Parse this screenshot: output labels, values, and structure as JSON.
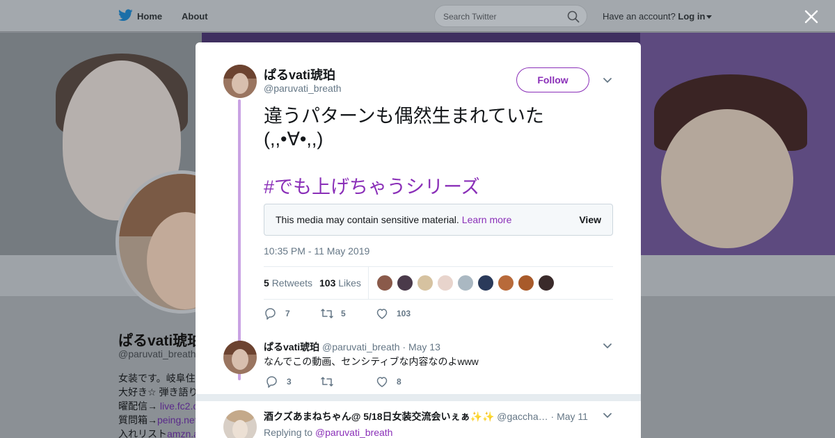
{
  "nav": {
    "home": "Home",
    "about": "About",
    "search_placeholder": "Search Twitter",
    "have_account": "Have an account?",
    "login": "Log in"
  },
  "background_profile": {
    "name": "ぱるvati琥珀",
    "handle": "@paruvati_breath",
    "bio_lines": [
      {
        "text": "女装です。岐阜住",
        "link": ""
      },
      {
        "text": "大好き☆ 弾き語り",
        "link": ""
      },
      {
        "text": "曜配信→ ",
        "link": "live.fc2.c"
      },
      {
        "text": "質問箱→",
        "link": "peing.net"
      },
      {
        "text": "入れリスト",
        "link": "amzn.a"
      }
    ]
  },
  "tweet": {
    "author_name": "ぱるvati琥珀",
    "author_handle": "@paruvati_breath",
    "follow_label": "Follow",
    "text_line1": "違うパターンも偶然生まれていた",
    "text_line2": "(,,•∀•,,)",
    "hashtag": "#でも上げちゃうシリーズ",
    "sensitive_message": "This media may contain sensitive material.",
    "learn_more": "Learn more",
    "view_label": "View",
    "timestamp": "10:35 PM - 11 May 2019",
    "retweets_count": "5",
    "retweets_label": "Retweets",
    "likes_count": "103",
    "likes_label": "Likes",
    "actions": {
      "reply": "7",
      "retweet": "5",
      "like": "103"
    },
    "liker_avatar_colors": [
      "#8a5a4a",
      "#4a3a4a",
      "#d6c2a0",
      "#e8d4cc",
      "#aab8c2",
      "#2a3a5a",
      "#b86a3a",
      "#a85a2a",
      "#3a2a2a"
    ]
  },
  "replies": [
    {
      "name": "ぱるvati琥珀",
      "handle": "@paruvati_breath",
      "date": "· May 13",
      "text": "なんでこの動画、センシティブな内容なのよwww",
      "reply_count": "3",
      "retweet_count": "",
      "like_count": "8"
    },
    {
      "name": "酒クズあまねちゃん@ 5/18日女装交流会いぇぁ✨✨",
      "handle": "@gaccha…",
      "date": "· May 11",
      "replying_to_label": "Replying to",
      "replying_to_handle": "@paruvati_breath"
    }
  ],
  "colors": {
    "accent": "#8a2fb8",
    "thread_line": "#c9a3e3",
    "muted": "#657786"
  }
}
